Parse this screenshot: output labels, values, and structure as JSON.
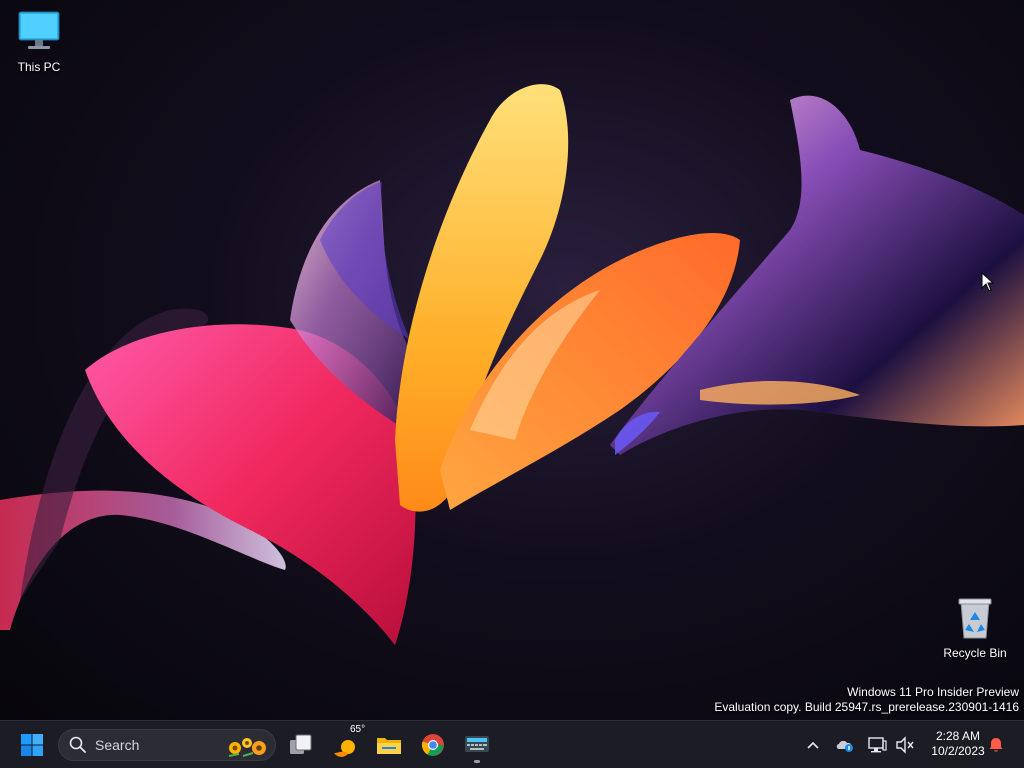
{
  "desktop": {
    "icons": [
      {
        "label": "This PC",
        "icon": "monitor-icon"
      },
      {
        "label": "Recycle Bin",
        "icon": "recycle-bin-icon"
      }
    ],
    "watermark": {
      "line1": "Windows 11 Pro Insider Preview",
      "line2": "Evaluation copy. Build 25947.rs_prerelease.230901-1416"
    }
  },
  "taskbar": {
    "start_icon": "windows-logo-icon",
    "search": {
      "placeholder": "Search"
    },
    "apps": [
      {
        "name": "Task View",
        "icon": "task-view-icon"
      },
      {
        "name": "Widgets",
        "icon": "weather-icon",
        "temp": "65°"
      },
      {
        "name": "File Explorer",
        "icon": "folder-icon"
      },
      {
        "name": "Google Chrome",
        "icon": "chrome-icon"
      },
      {
        "name": "Keyboard App",
        "icon": "keyboard-app-icon",
        "active": true
      }
    ],
    "tray": {
      "icons": [
        "chevron-up-icon",
        "onedrive-icon",
        "network-icon",
        "volume-muted-icon"
      ],
      "time": "2:28 AM",
      "date": "10/2/2023",
      "notification_icon": "notification-bell-icon"
    }
  },
  "colors": {
    "accent": "#0a84ff",
    "taskbar_bg": "#1c1c24",
    "notification": "#ff5a4a"
  }
}
